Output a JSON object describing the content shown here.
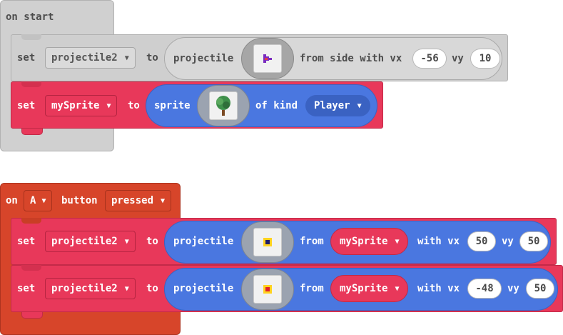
{
  "on_start": {
    "hat_label": "on start",
    "row1": {
      "set_label": "set",
      "variable": "projectile2",
      "to_label": "to",
      "func_label": "projectile",
      "from_label": "from side with vx",
      "vx": "-56",
      "vy_label": "vy",
      "vy": "10"
    },
    "row2": {
      "set_label": "set",
      "variable": "mySprite",
      "to_label": "to",
      "func_label": "sprite",
      "of_kind_label": "of kind",
      "kind": "Player"
    }
  },
  "on_button": {
    "on_label": "on",
    "button": "A",
    "button_label": "button",
    "event": "pressed",
    "row1": {
      "set_label": "set",
      "variable": "projectile2",
      "to_label": "to",
      "func_label": "projectile",
      "from_label": "from",
      "source": "mySprite",
      "with_vx_label": "with vx",
      "vx": "50",
      "vy_label": "vy",
      "vy": "50"
    },
    "row2": {
      "set_label": "set",
      "variable": "projectile2",
      "to_label": "to",
      "func_label": "projectile",
      "from_label": "from",
      "source": "mySprite",
      "with_vx_label": "with vx",
      "vx": "-48",
      "vy_label": "vy",
      "vy": "50"
    }
  },
  "icons": {
    "dropdown": "caret-down-icon",
    "projectile_image_1": "purple-arrow-sprite",
    "sprite_image": "tree-sprite",
    "projectile_image_2": "yellow-dot-sprite",
    "projectile_image_3": "yellow-dot-sprite"
  },
  "colors": {
    "gray_block": "#cfcfcf",
    "red_event": "#d7452a",
    "set_block": "#e8385a",
    "sprite_block": "#4a77e0"
  }
}
